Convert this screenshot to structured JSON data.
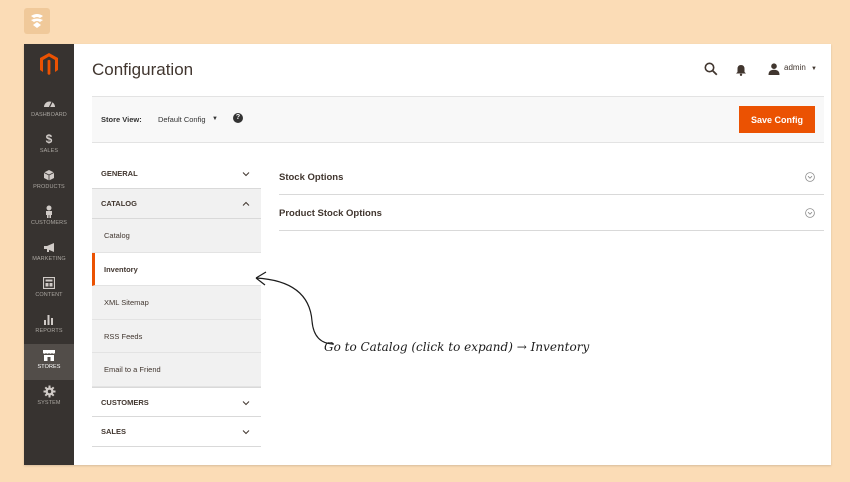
{
  "nav": {
    "items": [
      {
        "label": "DASHBOARD",
        "icon": "dashboard-icon"
      },
      {
        "label": "SALES",
        "icon": "dollar-icon"
      },
      {
        "label": "PRODUCTS",
        "icon": "box-icon"
      },
      {
        "label": "CUSTOMERS",
        "icon": "person-icon"
      },
      {
        "label": "MARKETING",
        "icon": "megaphone-icon"
      },
      {
        "label": "CONTENT",
        "icon": "layout-icon"
      },
      {
        "label": "REPORTS",
        "icon": "bar-chart-icon"
      },
      {
        "label": "STORES",
        "icon": "store-icon"
      },
      {
        "label": "SYSTEM",
        "icon": "gear-icon"
      }
    ]
  },
  "header": {
    "title": "Configuration",
    "user": "admin"
  },
  "store_view": {
    "label": "Store View:",
    "value": "Default Config",
    "help": "?"
  },
  "save_button": "Save Config",
  "tree": {
    "general": "GENERAL",
    "catalog": "CATALOG",
    "catalog_items": [
      "Catalog",
      "Inventory",
      "XML Sitemap",
      "RSS Feeds",
      "Email to a Friend"
    ],
    "customers": "CUSTOMERS",
    "sales": "SALES"
  },
  "sections": [
    "Stock Options",
    "Product Stock Options"
  ],
  "annotation": "Go to Catalog (click to expand) → Inventory",
  "colors": {
    "background": "#fbdcb6",
    "nav": "#373330",
    "accent": "#eb5202"
  }
}
